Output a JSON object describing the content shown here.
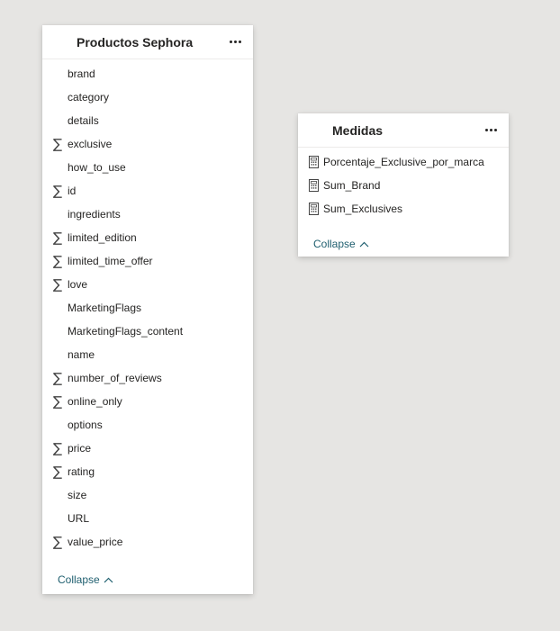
{
  "tables": {
    "productos": {
      "title": "Productos Sephora",
      "more_label": "...",
      "fields": [
        {
          "label": "brand",
          "icon": "none"
        },
        {
          "label": "category",
          "icon": "none"
        },
        {
          "label": "details",
          "icon": "none"
        },
        {
          "label": "exclusive",
          "icon": "sigma-icon"
        },
        {
          "label": "how_to_use",
          "icon": "none"
        },
        {
          "label": "id",
          "icon": "sigma-icon"
        },
        {
          "label": "ingredients",
          "icon": "none"
        },
        {
          "label": "limited_edition",
          "icon": "sigma-icon"
        },
        {
          "label": "limited_time_offer",
          "icon": "sigma-icon"
        },
        {
          "label": "love",
          "icon": "sigma-icon"
        },
        {
          "label": "MarketingFlags",
          "icon": "none"
        },
        {
          "label": "MarketingFlags_content",
          "icon": "none"
        },
        {
          "label": "name",
          "icon": "none"
        },
        {
          "label": "number_of_reviews",
          "icon": "sigma-icon"
        },
        {
          "label": "online_only",
          "icon": "sigma-icon"
        },
        {
          "label": "options",
          "icon": "none"
        },
        {
          "label": "price",
          "icon": "sigma-icon"
        },
        {
          "label": "rating",
          "icon": "sigma-icon"
        },
        {
          "label": "size",
          "icon": "none"
        },
        {
          "label": "URL",
          "icon": "none"
        },
        {
          "label": "value_price",
          "icon": "sigma-icon"
        }
      ],
      "collapse_label": "Collapse"
    },
    "medidas": {
      "title": "Medidas",
      "more_label": "...",
      "fields": [
        {
          "label": "Porcentaje_Exclusive_por_marca",
          "icon": "calculator-icon"
        },
        {
          "label": "Sum_Brand",
          "icon": "calculator-icon"
        },
        {
          "label": "Sum_Exclusives",
          "icon": "calculator-icon"
        }
      ],
      "collapse_label": "Collapse"
    }
  },
  "colors": {
    "canvas": "#e6e5e3",
    "card": "#ffffff",
    "link": "#1f5f6f"
  }
}
